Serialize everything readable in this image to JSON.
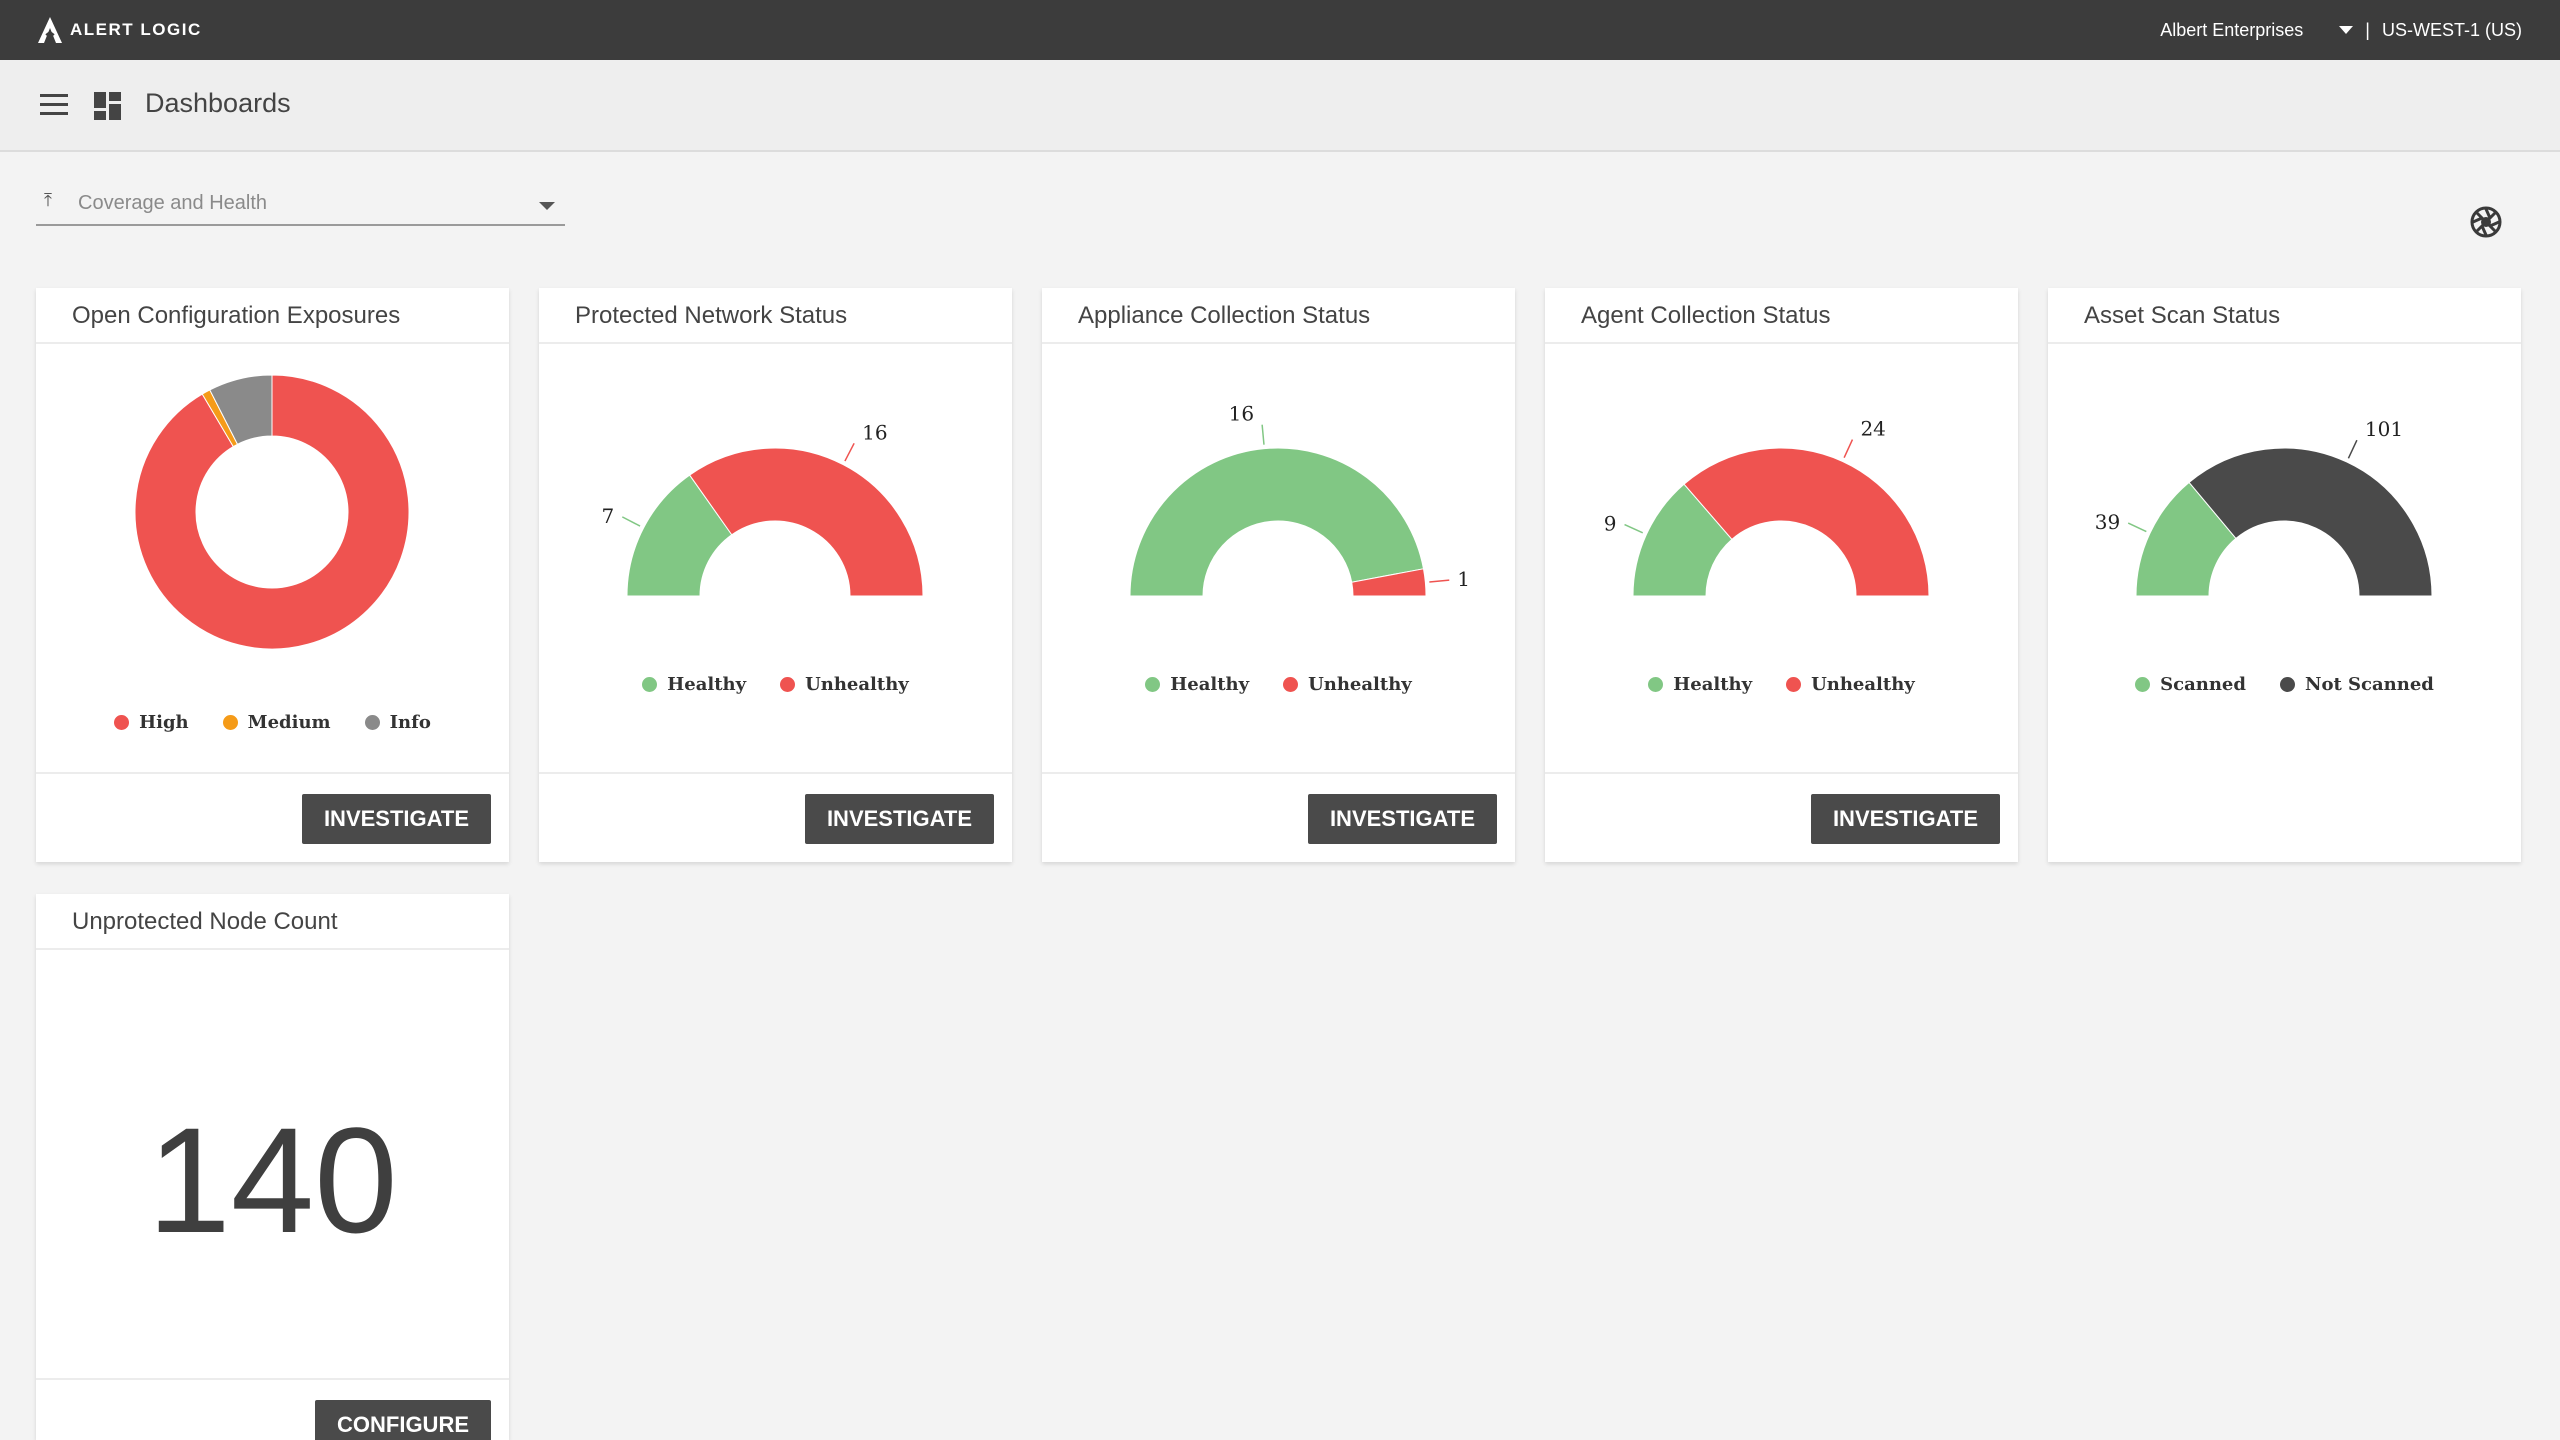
{
  "topbar": {
    "logo_text": "ALERT LOGIC",
    "account_name": "Albert Enterprises",
    "separator": "|",
    "region": "US-WEST-1 (US)"
  },
  "subheader": {
    "title": "Dashboards"
  },
  "filter": {
    "value": "Coverage and Health"
  },
  "colors": {
    "high": "#ef5350",
    "medium": "#f59b18",
    "info": "#8a8a8a",
    "healthy": "#81c784",
    "unhealthy": "#ef5350",
    "not_scanned": "#4a4a4a",
    "button": "#4a4a4a",
    "topbar": "#3c3c3c"
  },
  "cards": [
    {
      "title": "Open Configuration Exposures",
      "button": "INVESTIGATE",
      "legend": [
        "High",
        "Medium",
        "Info"
      ]
    },
    {
      "title": "Protected Network Status",
      "button": "INVESTIGATE",
      "legend": [
        "Healthy",
        "Unhealthy"
      ]
    },
    {
      "title": "Appliance Collection Status",
      "button": "INVESTIGATE",
      "legend": [
        "Healthy",
        "Unhealthy"
      ]
    },
    {
      "title": "Agent Collection Status",
      "button": "INVESTIGATE",
      "legend": [
        "Healthy",
        "Unhealthy"
      ]
    },
    {
      "title": "Asset Scan Status",
      "legend": [
        "Scanned",
        "Not Scanned"
      ]
    },
    {
      "title": "Unprotected Node Count",
      "value": "140",
      "button": "CONFIGURE"
    }
  ],
  "chart_data": [
    {
      "type": "pie",
      "title": "Open Configuration Exposures",
      "series": [
        {
          "name": "High",
          "value": 91.5,
          "color": "#ef5350"
        },
        {
          "name": "Medium",
          "value": 1.0,
          "color": "#f59b18"
        },
        {
          "name": "Info",
          "value": 7.5,
          "color": "#8a8a8a"
        }
      ]
    },
    {
      "type": "pie",
      "title": "Protected Network Status",
      "series": [
        {
          "name": "Healthy",
          "value": 7,
          "color": "#81c784"
        },
        {
          "name": "Unhealthy",
          "value": 16,
          "color": "#ef5350"
        }
      ]
    },
    {
      "type": "pie",
      "title": "Appliance Collection Status",
      "series": [
        {
          "name": "Healthy",
          "value": 16,
          "color": "#81c784"
        },
        {
          "name": "Unhealthy",
          "value": 1,
          "color": "#ef5350"
        }
      ]
    },
    {
      "type": "pie",
      "title": "Agent Collection Status",
      "series": [
        {
          "name": "Healthy",
          "value": 9,
          "color": "#81c784"
        },
        {
          "name": "Unhealthy",
          "value": 24,
          "color": "#ef5350"
        }
      ]
    },
    {
      "type": "pie",
      "title": "Asset Scan Status",
      "series": [
        {
          "name": "Scanned",
          "value": 39,
          "color": "#81c784"
        },
        {
          "name": "Not Scanned",
          "value": 101,
          "color": "#4a4a4a"
        }
      ]
    }
  ]
}
